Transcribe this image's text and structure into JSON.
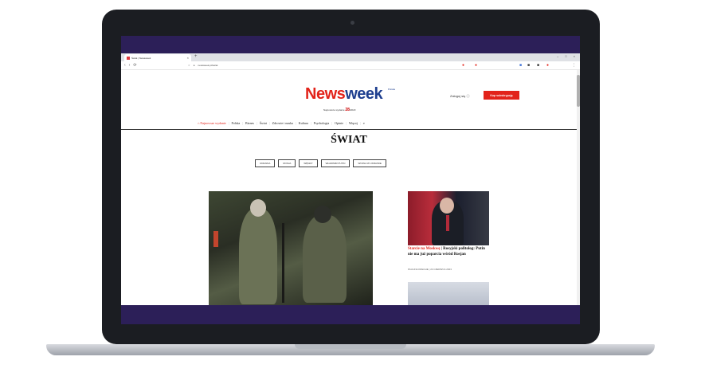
{
  "browser": {
    "tab_title": "Świat | Newsweek",
    "tab_close": "×",
    "new_tab": "+",
    "url": "newsweek.pl/swiat",
    "window_controls": [
      "–",
      "□",
      "×"
    ]
  },
  "site": {
    "logo_part1": "News",
    "logo_part2": "week",
    "logo_tag": "Polska",
    "issue_prefix": "Najnowsze wydanie",
    "issue_number": "28",
    "issue_suffix": "/2023",
    "login": "Zaloguj się ⓘ",
    "subscribe": "Kup subskrypcję"
  },
  "nav": {
    "latest": "Najnowsze wydanie",
    "items": [
      "Polska",
      "Biznes",
      "Świat",
      "Zdrowie i nauka",
      "Kultura",
      "Psychologia",
      "Opinie",
      "Więcej"
    ],
    "search_icon": "search-icon"
  },
  "section": {
    "title": "ŚWIAT",
    "tags": [
      "UKRAINA",
      "ROSJA",
      "WĘGRY",
      "WŁADIMIR PUTIN",
      "WOJNA W UKRAINIE"
    ]
  },
  "side_article": {
    "kicker": "Starcie na Moskwę",
    "headline": "Rosyjski politolog: Putin nie ma już poparcia wśród Rosjan",
    "author": "PAULINA KRECHE",
    "date": "24 CZERWCA 2023"
  },
  "colors": {
    "accent": "#e2231a",
    "logo_blue": "#1e3f8f",
    "screen_bg": "#2c1f58"
  }
}
